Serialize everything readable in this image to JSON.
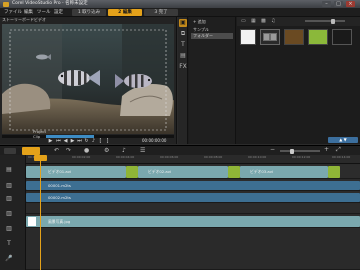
{
  "window": {
    "title": "Corel VideoStudio Pro - 名称未設定"
  },
  "menu": {
    "items": [
      "ファイル",
      "編集",
      "ツール",
      "設定"
    ],
    "steps": [
      {
        "label": "1 取り込み",
        "active": false
      },
      {
        "label": "2 編集",
        "active": true
      },
      {
        "label": "3 完了",
        "active": false
      }
    ]
  },
  "preview": {
    "title": "ストーリーボードビデオ",
    "project_label": "Project",
    "clip_label": "Clip",
    "timecode": "00:00:00:00"
  },
  "library": {
    "tree": [
      "追加",
      "サンプル",
      "フォルダー"
    ],
    "selected_folder": "フォルダー"
  },
  "timeline": {
    "ruler_ticks": [
      "00:00:00:00",
      "00:00:02:00",
      "00:00:04:00",
      "00:00:06:00",
      "00:00:08:00",
      "00:00:10:00",
      "00:00:12:00",
      "00:00:14:00",
      "00:00:16:00",
      "00:00:18:00",
      "00:00:20:00",
      "00:00:22:00",
      "00:00:24:00",
      "00:00:26:00",
      "00:00:28:00"
    ],
    "video_clips": [
      "ビデオ01.avi",
      "ビデオ02.avi",
      "ビデオ03.avi"
    ],
    "overlay_clips": [
      "00001.m2ts",
      "00002.m2ts"
    ],
    "title_clip": "最初のタイトル",
    "image_clip": "風景写真.jpg"
  },
  "colors": {
    "accent": "#e4a21a",
    "clip_teal": "#7aa8ae",
    "transition_green": "#8fb537",
    "overlay_blue": "#3d6f92"
  }
}
